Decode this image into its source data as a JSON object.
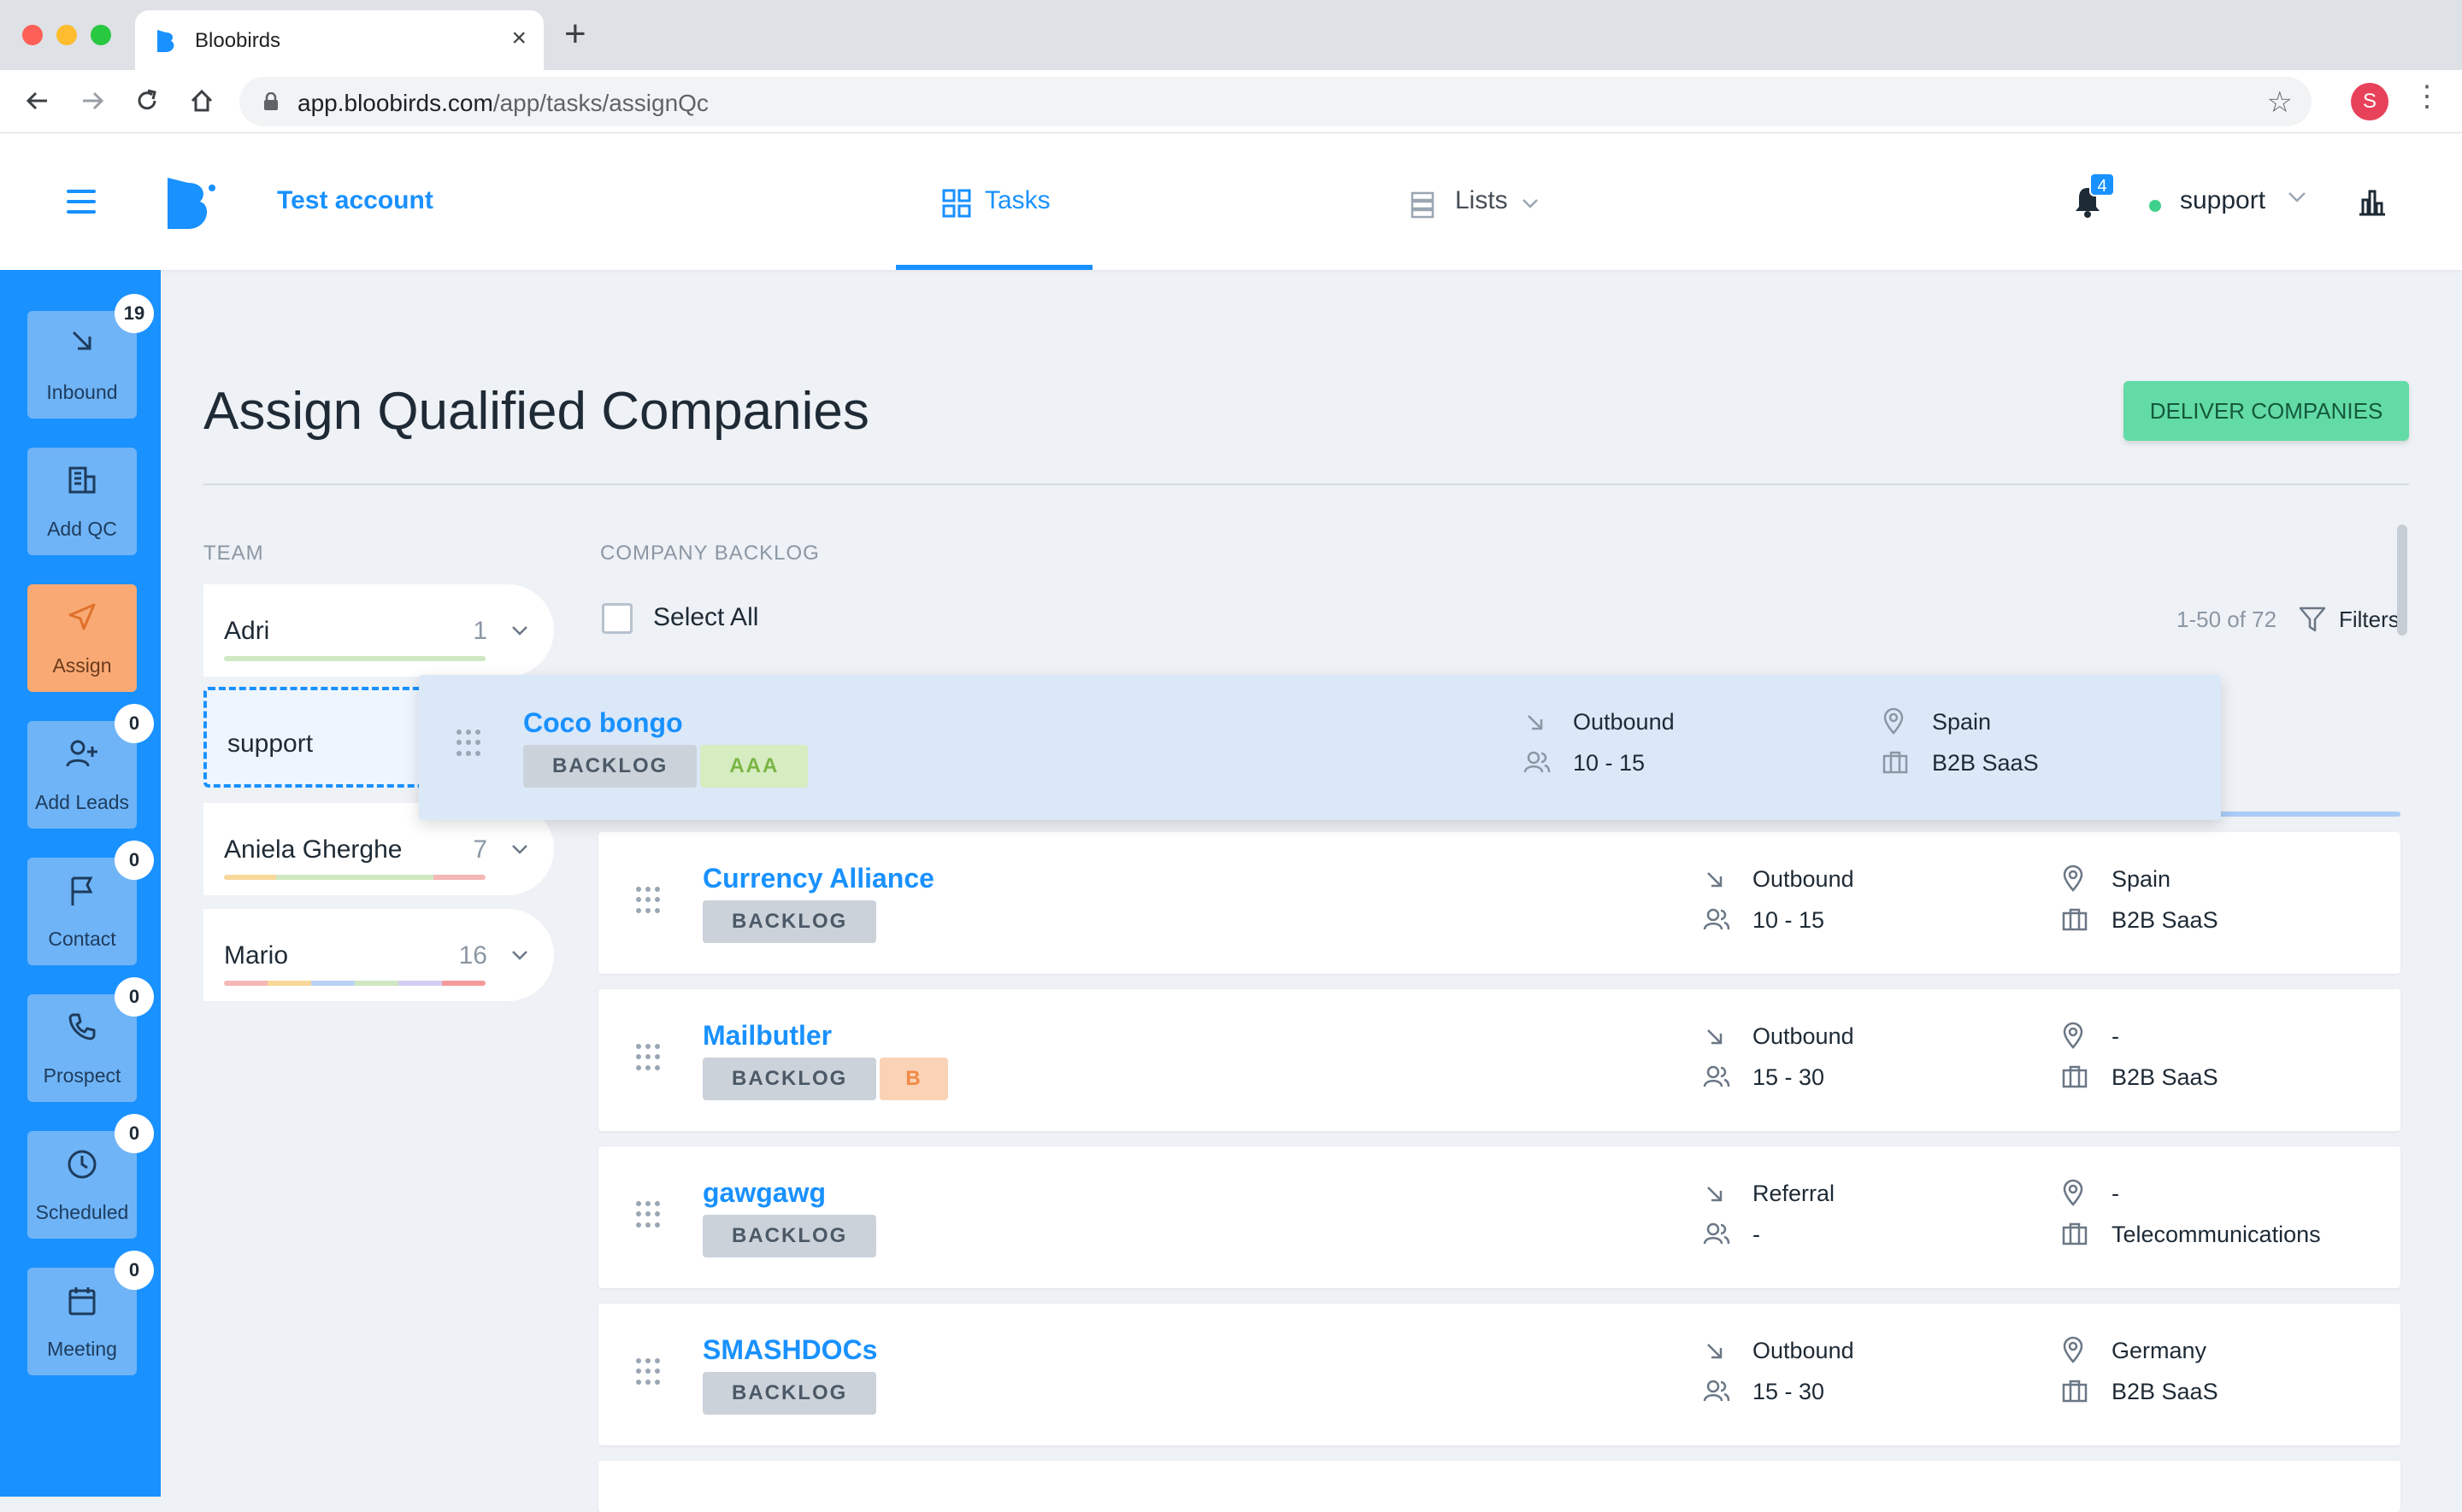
{
  "browser": {
    "tab_title": "Bloobirds",
    "url_host": "app.bloobirds.com",
    "url_path": "/app/tasks/assignQc",
    "profile_initial": "S"
  },
  "header": {
    "account": "Test account",
    "nav_tasks": "Tasks",
    "nav_lists": "Lists",
    "notifications": "4",
    "user": "support"
  },
  "sidebar": [
    {
      "label": "Inbound",
      "badge": "19"
    },
    {
      "label": "Add QC",
      "badge": ""
    },
    {
      "label": "Assign",
      "badge": ""
    },
    {
      "label": "Add Leads",
      "badge": "0"
    },
    {
      "label": "Contact",
      "badge": "0"
    },
    {
      "label": "Prospect",
      "badge": "0"
    },
    {
      "label": "Scheduled",
      "badge": "0"
    },
    {
      "label": "Meeting",
      "badge": "0"
    }
  ],
  "page": {
    "title": "Assign Qualified Companies",
    "deliver_button": "DELIVER COMPANIES",
    "team_heading": "TEAM",
    "backlog_heading": "COMPANY BACKLOG",
    "select_all": "Select All",
    "pagination": "1-50 of 72",
    "filters": "Filters"
  },
  "team": [
    {
      "name": "Adri",
      "count": "1"
    },
    {
      "name": "support",
      "count": ""
    },
    {
      "name": "Aniela Gherghe",
      "count": "7"
    },
    {
      "name": "Mario",
      "count": "16"
    }
  ],
  "dragging_company": {
    "name": "Coco bongo",
    "status": "BACKLOG",
    "rating": "AAA",
    "source": "Outbound",
    "size": "10 - 15",
    "country": "Spain",
    "industry": "B2B SaaS"
  },
  "companies": [
    {
      "name": "Currency Alliance",
      "status": "BACKLOG",
      "rating": "",
      "source": "Outbound",
      "size": "10 - 15",
      "country": "Spain",
      "industry": "B2B SaaS"
    },
    {
      "name": "Mailbutler",
      "status": "BACKLOG",
      "rating": "B",
      "source": "Outbound",
      "size": "15 - 30",
      "country": "-",
      "industry": "B2B SaaS"
    },
    {
      "name": "gawgawg",
      "status": "BACKLOG",
      "rating": "",
      "source": "Referral",
      "size": "-",
      "country": "-",
      "industry": "Telecommunications"
    },
    {
      "name": "SMASHDOCs",
      "status": "BACKLOG",
      "rating": "",
      "source": "Outbound",
      "size": "15 - 30",
      "country": "Germany",
      "industry": "B2B SaaS"
    }
  ],
  "colors": {
    "brand": "#1991ff",
    "deliver": "#63dba6",
    "assign_active": "#f9aa74"
  }
}
